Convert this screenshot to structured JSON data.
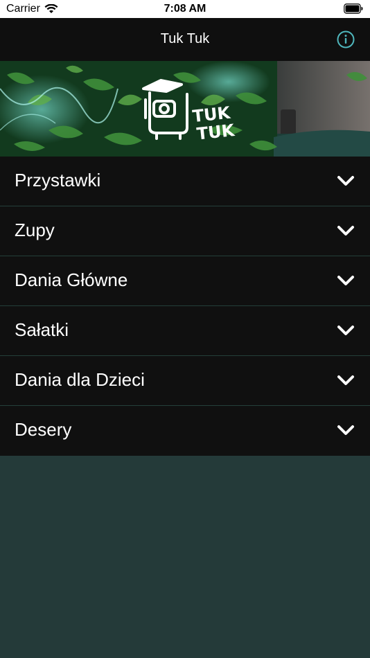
{
  "status_bar": {
    "carrier": "Carrier",
    "time": "7:08 AM",
    "icons": [
      "wifi-icon",
      "battery-icon"
    ]
  },
  "nav": {
    "title": "Tuk Tuk",
    "info_icon": "info-icon"
  },
  "banner": {
    "logo_text_line1": "TUK",
    "logo_text_line2": "TUK"
  },
  "menu": {
    "items": [
      {
        "label": "Przystawki"
      },
      {
        "label": "Zupy"
      },
      {
        "label": "Dania Główne"
      },
      {
        "label": "Sałatki"
      },
      {
        "label": "Dania dla Dzieci"
      },
      {
        "label": "Desery"
      }
    ],
    "expand_icon": "chevron-down-icon"
  },
  "colors": {
    "nav_background": "#0f0f0f",
    "row_background": "#101010",
    "divider": "#24403a",
    "page_background": "#243a39",
    "accent": "#4fb7bd"
  }
}
